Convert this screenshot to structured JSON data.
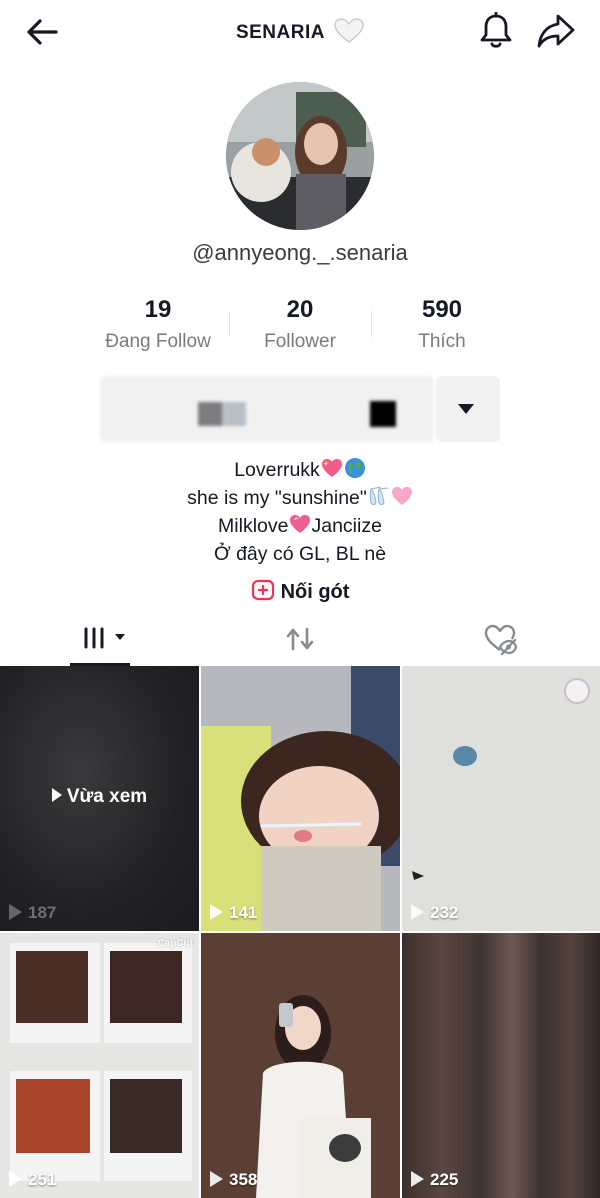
{
  "header": {
    "title": "SENARIA",
    "back_icon": "arrow-left-icon",
    "title_emoji": "white-heart-icon",
    "bell_icon": "bell-icon",
    "share_icon": "share-arrow-icon"
  },
  "profile": {
    "avatar_icon": "profile-photo",
    "username": "@annyeong._.senaria"
  },
  "stats": [
    {
      "value": "19",
      "label": "Đang Follow"
    },
    {
      "value": "20",
      "label": "Follower"
    },
    {
      "value": "590",
      "label": "Thích"
    }
  ],
  "actions": {
    "dropdown_icon": "caret-down-icon"
  },
  "bio": {
    "lines": [
      "Loverrukk",
      "she is my \"sunshine\"",
      "Milklove",
      "Janciize",
      "Ở đây có GL, BL nè"
    ]
  },
  "link": {
    "label": "Nối gót",
    "icon": "link-plus-icon"
  },
  "tabs": {
    "videos_icon": "videos-grid-icon",
    "reposts_icon": "repost-icon",
    "liked_icon": "hidden-liked-icon"
  },
  "videos": [
    {
      "views": "187",
      "overlay": "Vừa xem"
    },
    {
      "views": "141"
    },
    {
      "views": "232"
    },
    {
      "views": "251",
      "watermark": "CapCut"
    },
    {
      "views": "358"
    },
    {
      "views": "225"
    }
  ],
  "colors": {
    "text": "#161823",
    "muted": "#7a7b80",
    "accent": "#fe2c55"
  }
}
